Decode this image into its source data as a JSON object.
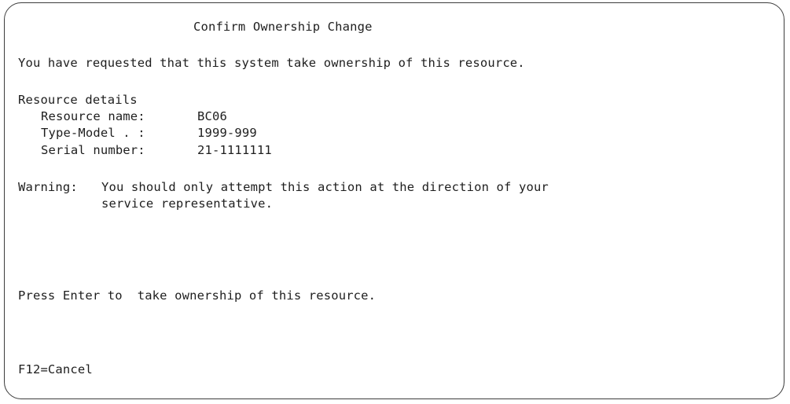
{
  "screen": {
    "title": "Confirm Ownership Change",
    "intro": "You have requested that this system take ownership of this resource.",
    "details": {
      "heading": "Resource details",
      "items": [
        {
          "label": "Resource name:",
          "value": "BC06"
        },
        {
          "label": "Type-Model . :",
          "value": "1999-999"
        },
        {
          "label": "Serial number:",
          "value": "21-1111111"
        }
      ]
    },
    "warning": {
      "label": "Warning:",
      "line1": "You should only attempt this action at the direction of your",
      "line2": "service representative."
    },
    "instruction": "Press Enter to  take ownership of this resource.",
    "function_keys": {
      "f12": "F12=Cancel"
    }
  }
}
